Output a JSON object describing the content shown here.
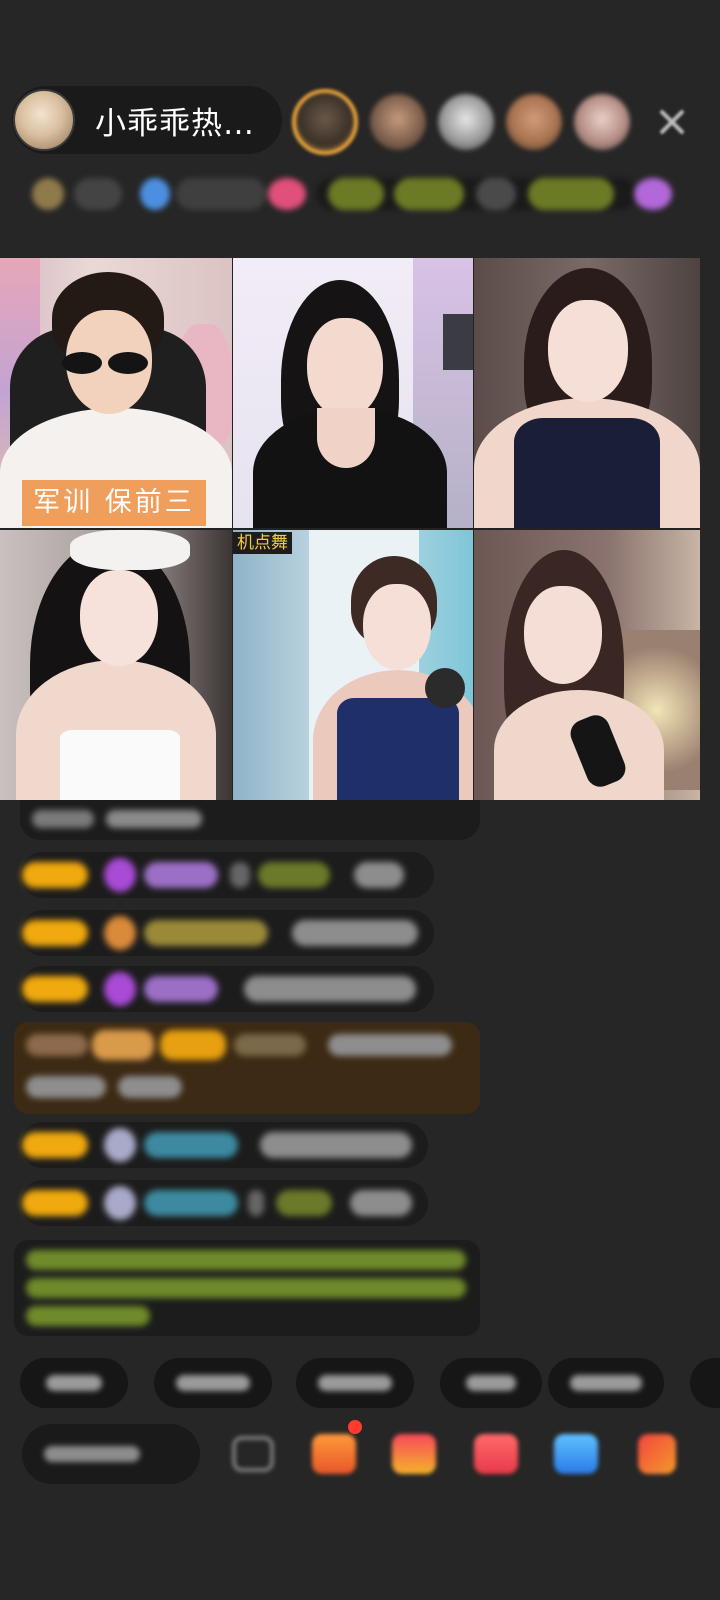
{
  "header": {
    "host_name": "小乖乖热…",
    "viewer_avatars": [
      "avatar",
      "avatar",
      "avatar",
      "avatar",
      "avatar"
    ],
    "close_icon": "close-icon"
  },
  "video_grid": {
    "tiles": [
      {
        "caption": "军训  保前三"
      },
      {
        "caption": ""
      },
      {
        "caption": ""
      },
      {
        "caption": ""
      },
      {
        "tag": "机点舞"
      },
      {
        "caption": ""
      }
    ]
  },
  "colors": {
    "background": "#262626",
    "badge_gold": "#f0a90e",
    "gift_gold": "#e8a23a",
    "caption_orange": "#ee9248"
  },
  "toolbar": {
    "icons": [
      "chat-icon",
      "gift-box-icon",
      "gift-bag-icon",
      "red-packet-icon",
      "game-icon",
      "more-icon"
    ]
  }
}
